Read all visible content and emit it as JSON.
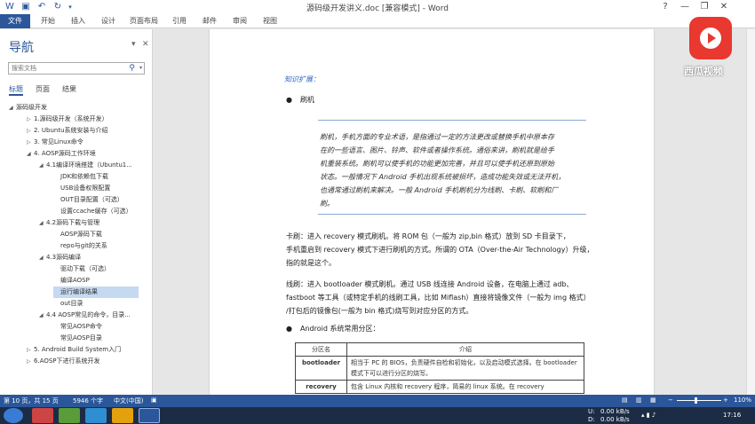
{
  "window": {
    "title": "源码级开发讲义.doc [兼容模式] - Word",
    "help": "?",
    "minimize": "—",
    "restore": "❐",
    "close": "✕"
  },
  "ribbon_tabs": [
    "文件",
    "开始",
    "插入",
    "设计",
    "页面布局",
    "引用",
    "邮件",
    "审阅",
    "视图"
  ],
  "nav": {
    "title": "导航",
    "search_placeholder": "搜索文档",
    "tabs": [
      "标题",
      "页面",
      "结果"
    ],
    "tree": [
      {
        "label": "源码级开发",
        "toggle": "◢",
        "level": 0
      },
      {
        "label": "1.源码级开发（系统开发）",
        "toggle": "▷",
        "level": 1
      },
      {
        "label": "2. Ubuntu系统安装与介绍",
        "toggle": "▷",
        "level": 1
      },
      {
        "label": "3. 常见Linux命令",
        "toggle": "▷",
        "level": 1
      },
      {
        "label": "4. AOSP源码工作环境",
        "toggle": "◢",
        "level": 1
      },
      {
        "label": "4.1编译环境搭建（Ubuntu1...",
        "toggle": "◢",
        "level": 2
      },
      {
        "label": "JDK和依赖包下载",
        "toggle": "",
        "level": 3
      },
      {
        "label": "USB设备权限配置",
        "toggle": "",
        "level": 3
      },
      {
        "label": "OUT目录配置（可选）",
        "toggle": "",
        "level": 3
      },
      {
        "label": "设置ccache缓存（可选）",
        "toggle": "",
        "level": 3
      },
      {
        "label": "4.2源码下载与管理",
        "toggle": "◢",
        "level": 2
      },
      {
        "label": "AOSP源码下载",
        "toggle": "",
        "level": 3
      },
      {
        "label": "repo与git的关系",
        "toggle": "",
        "level": 3
      },
      {
        "label": "4.3源码编译",
        "toggle": "◢",
        "level": 2
      },
      {
        "label": "驱动下载（可选）",
        "toggle": "",
        "level": 3
      },
      {
        "label": "编译AOSP",
        "toggle": "",
        "level": 3
      },
      {
        "label": "运行编译结果",
        "toggle": "",
        "level": 3,
        "selected": true
      },
      {
        "label": "out目录",
        "toggle": "",
        "level": 3
      },
      {
        "label": "4.4 AOSP常见的命令，目录...",
        "toggle": "◢",
        "level": 2
      },
      {
        "label": "常见AOSP命令",
        "toggle": "",
        "level": 3
      },
      {
        "label": "常见AOSP目录",
        "toggle": "",
        "level": 3
      },
      {
        "label": "5. Android Build System入门",
        "toggle": "▷",
        "level": 1
      },
      {
        "label": "6.AOSP下进行系统开发",
        "toggle": "▷",
        "level": 1
      }
    ]
  },
  "doc": {
    "knowledge": "知识扩展：",
    "bullet1": "刷机",
    "box_lines": [
      "刷机，手机方面的专业术语，是指通过一定的方法更改或替换手机中原本存",
      "在的一些语言、图片、铃声、软件或者操作系统。通俗来讲，刷机就是给手",
      "机重装系统。刷机可以使手机的功能更加完善，并且可以使手机还原到原始",
      "状态。一般情况下 Android 手机出现系统被损坏，造成功能失效或无法开机，",
      "也通常通过刷机来解决。一般 Android 手机刷机分为线刷、卡刷、软刷和厂",
      "刷。"
    ],
    "card_lines": [
      "卡刷：进入 recovery 模式刷机。将 ROM 包（一般为 zip,bin 格式）放到 SD 卡目录下，",
      "手机重启到 recovery 模式下进行刷机的方式。所谓的 OTA（Over-the-Air Technology）升级，",
      "指的就是这个。"
    ],
    "line_lines": [
      "线刷：进入 bootloader 模式刷机。通过 USB 线连接 Android 设备，在电脑上通过 adb、",
      "fastboot 等工具（或特定手机的线刷工具，比如 Miflash）直接将镜像文件（一般为 img 格式）",
      "/打包后的镜像包(一般为 bin 格式)烧写到对应分区的方式。"
    ],
    "bullet2": "Android 系统常用分区：",
    "table": {
      "headers": [
        "分区名",
        "介绍"
      ],
      "rows": [
        [
          "bootloader",
          "相当于 PC 的 BIOS，负责硬件自检和初始化，以及启动模式选择。在 bootloader 模式下可以进行分区的烧写。"
        ],
        [
          "recovery",
          "包含 Linux 内核和 recovery 程序，简易的 linux 系统。在 recovery"
        ]
      ]
    }
  },
  "status": {
    "page": "第 10 页，共 15 页",
    "words": "5946 个字",
    "lang": "中文(中国)",
    "zoom": "110%"
  },
  "taskbar": {
    "upload": "0.00 kB/s",
    "download": "0.00 kB/s",
    "u_label": "U:",
    "d_label": "D:",
    "time": "17:16"
  },
  "watermark": {
    "text": "西瓜视频"
  },
  "colors": {
    "accent": "#2b579a",
    "watermark_red": "#e8382f"
  }
}
